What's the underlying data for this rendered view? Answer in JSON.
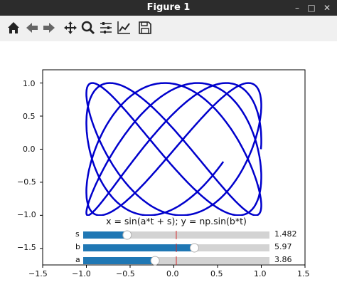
{
  "window": {
    "title": "Figure 1",
    "minimize": "–",
    "maximize": "□",
    "close": "✕"
  },
  "toolbar": {
    "buttons": [
      {
        "name": "home-icon",
        "glyph": "home"
      },
      {
        "name": "back-icon",
        "glyph": "back"
      },
      {
        "name": "forward-icon",
        "glyph": "forward"
      },
      {
        "name": "pan-icon",
        "glyph": "pan"
      },
      {
        "name": "zoom-icon",
        "glyph": "zoom"
      },
      {
        "name": "subplots-icon",
        "glyph": "subplots"
      },
      {
        "name": "edit-axes-icon",
        "glyph": "axes"
      },
      {
        "name": "save-icon",
        "glyph": "save"
      }
    ]
  },
  "plot": {
    "title": "x = sin(a*t + s); y = np.sin(b*t)",
    "x_ticks": [
      "−1.5",
      "−1.0",
      "−0.5",
      "0.0",
      "0.5",
      "1.0",
      "1.5"
    ],
    "y_ticks": [
      "1.0",
      "0.5",
      "0.0",
      "−0.5",
      "−1.0",
      "−1.5"
    ],
    "line_color": "#0000cc"
  },
  "sliders": [
    {
      "label": "s",
      "value": 1.482,
      "value_text": "1.482",
      "min": 0,
      "max": 6.283,
      "init": 3.14
    },
    {
      "label": "b",
      "value": 5.97,
      "value_text": "5.97",
      "min": 0,
      "max": 10,
      "init": 5.0
    },
    {
      "label": "a",
      "value": 3.86,
      "value_text": "3.86",
      "min": 0,
      "max": 10,
      "init": 5.0
    }
  ],
  "chart_data": {
    "type": "line",
    "title": "x = sin(a*t + s); y = np.sin(b*t)",
    "xlim": [
      -1.5,
      1.5
    ],
    "ylim": [
      -1.75,
      1.2
    ],
    "params": {
      "a": 3.86,
      "b": 5.97,
      "s": 1.482
    },
    "t_range": [
      0,
      6.283
    ],
    "samples": 1200
  }
}
